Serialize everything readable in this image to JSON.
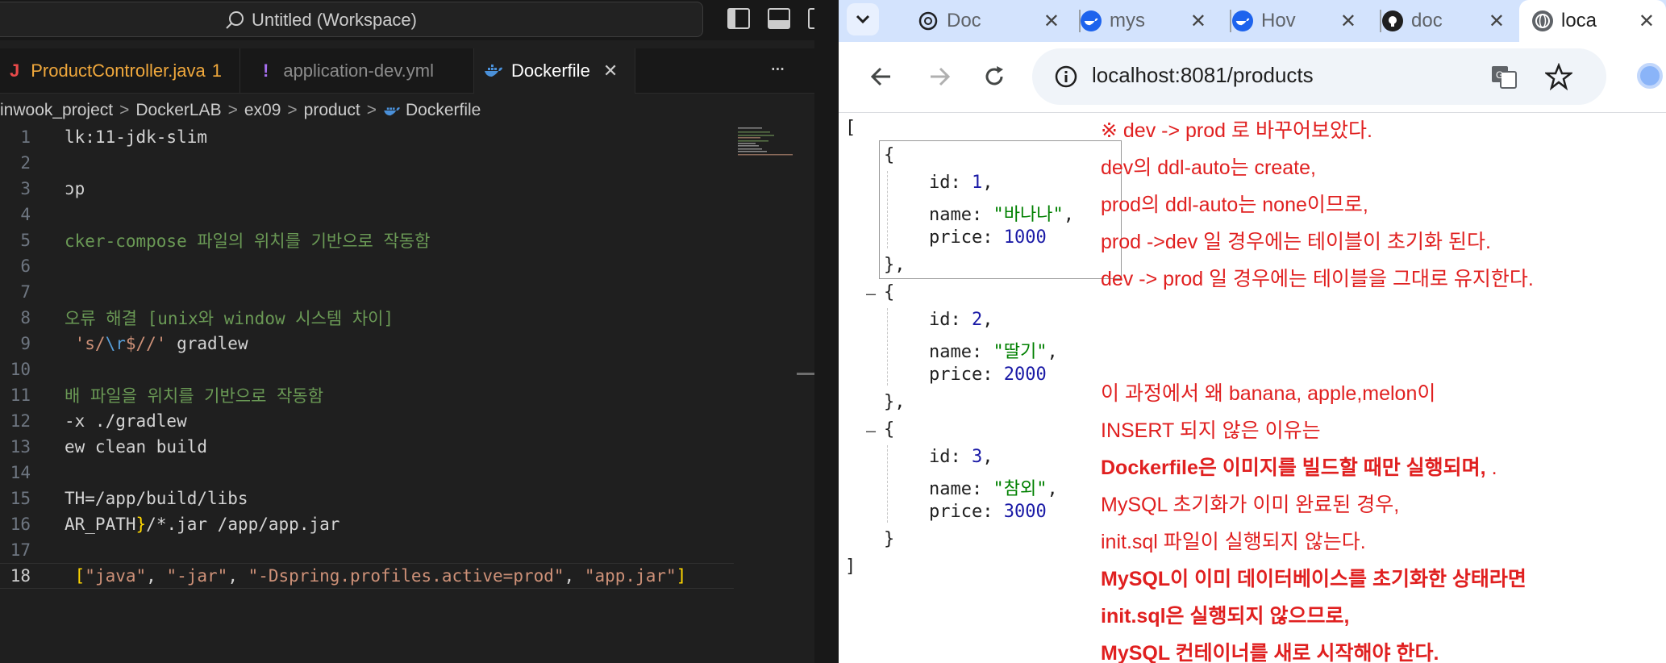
{
  "vscode": {
    "search_label": "Untitled (Workspace)",
    "tabs": [
      {
        "label": "ProductController.java",
        "badge": "1",
        "icon": "J"
      },
      {
        "label": "application-dev.yml",
        "icon": "!"
      },
      {
        "label": "Dockerfile",
        "icon": "docker-icon"
      }
    ],
    "more_actions": "···",
    "breadcrumb": [
      "inwook_project",
      "DockerLAB",
      "ex09",
      "product",
      "Dockerfile"
    ],
    "lines": [
      {
        "num": "1",
        "text": "lk:11-jdk-slim"
      },
      {
        "num": "2",
        "text": ""
      },
      {
        "num": "3",
        "text": "ɔp"
      },
      {
        "num": "4",
        "text": ""
      },
      {
        "num": "5",
        "text": "cker-compose 파일의 위치를 기반으로 작동함"
      },
      {
        "num": "6",
        "text": ""
      },
      {
        "num": "7",
        "text": ""
      },
      {
        "num": "8",
        "text": "오류 해결 [unix와 window 시스템 차이]"
      },
      {
        "num": "9",
        "text_a": " 's/",
        "text_b": "\\r",
        "text_c": "$//'",
        "text_d": " gradlew"
      },
      {
        "num": "10",
        "text": ""
      },
      {
        "num": "11",
        "text": "배 파일을 위치를 기반으로 작동함"
      },
      {
        "num": "12",
        "text": "-x ./gradlew"
      },
      {
        "num": "13",
        "text": "ew clean build"
      },
      {
        "num": "14",
        "text": ""
      },
      {
        "num": "15",
        "text": "TH=/app/build/libs"
      },
      {
        "num": "16",
        "text_a": "AR_PATH",
        "text_b": "}",
        "text_c": "/*.jar /app/app.jar"
      },
      {
        "num": "17",
        "text": ""
      },
      {
        "num": "18",
        "p1": " [",
        "s1": "\"java\"",
        "c1": ", ",
        "s2": "\"-jar\"",
        "c2": ", ",
        "s3": "\"-Dspring.profiles.active=prod\"",
        "c3": ", ",
        "s4": "\"app.jar\"",
        "p2": "]"
      }
    ]
  },
  "chrome": {
    "tabs": [
      {
        "label": "Doc",
        "icon": "openai-icon"
      },
      {
        "label": "mys",
        "icon": "docker-icon"
      },
      {
        "label": "Hov",
        "icon": "docker-icon"
      },
      {
        "label": "doc",
        "icon": "github-icon"
      },
      {
        "label": "loca",
        "icon": "globe-icon"
      }
    ],
    "url": "localhost:8081/products",
    "json": {
      "open_bracket": "[",
      "close_bracket": "]",
      "items": [
        {
          "id": "1",
          "name": "\"바나나\"",
          "price": "1000",
          "close": "},"
        },
        {
          "id": "2",
          "name": "\"딸기\"",
          "price": "2000",
          "close": "},"
        },
        {
          "id": "3",
          "name": "\"참외\"",
          "price": "3000",
          "close": "}"
        }
      ],
      "key_id": "id",
      "key_name": "name",
      "key_price": "price"
    },
    "notes": [
      "※ dev -> prod 로 바꾸어보았다.",
      "dev의 ddl-auto는 create,",
      "prod의 ddl-auto는 none이므로,",
      "prod ->dev 일 경우에는 테이블이 초기화 된다.",
      "dev -> prod 일 경우에는 테이블을 그대로 유지한다.",
      "이 과정에서 왜 banana, apple,melon이",
      "INSERT 되지 않은 이유는",
      "Dockerfile은 이미지를 빌드할 때만 실행되며,",
      "  .",
      "MySQL 초기화가 이미 완료된 경우,",
      "init.sql 파일이 실행되지 않는다.",
      "MySQL이 이미 데이터베이스를 초기화한 상태라면",
      "init.sql은 실행되지 않으므로,",
      "MySQL 컨테이너를 새로 시작해야 한다."
    ]
  }
}
